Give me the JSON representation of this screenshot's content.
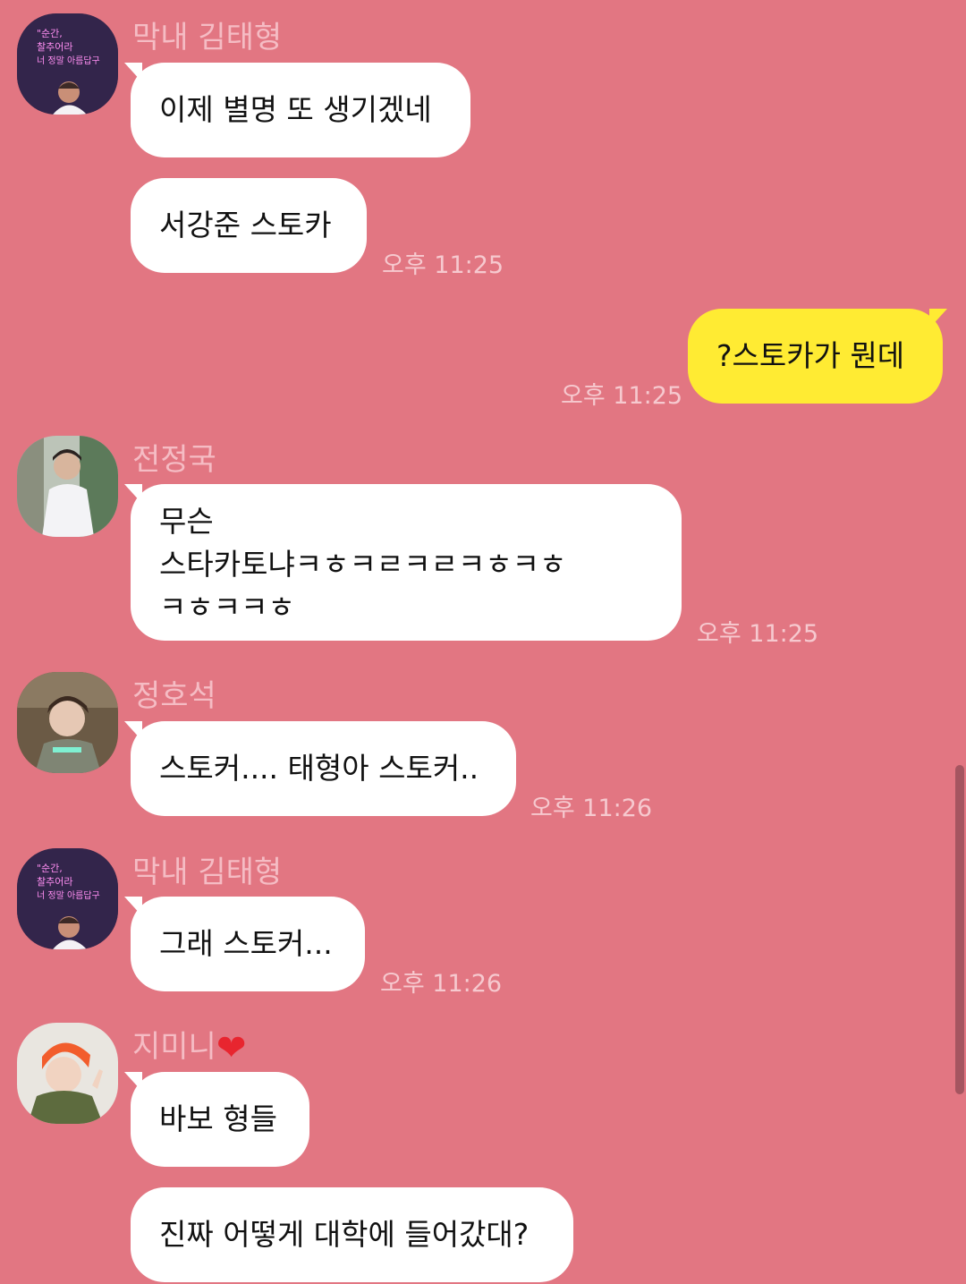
{
  "messages": [
    {
      "sender": "막내 김태형",
      "text": "이제 별명 또 생기겠네"
    },
    {
      "text": "서강준 스토카",
      "time": "오후 11:25"
    },
    {
      "text": "?스토카가 뭔데",
      "time": "오후 11:25"
    },
    {
      "sender": "전정국",
      "lines": [
        "무슨",
        "스타카토냐ㅋㅎㅋㄹㅋㄹㅋㅎㅋㅎ",
        "ㅋㅎㅋㅋㅎ"
      ],
      "time": "오후 11:25"
    },
    {
      "sender": "정호석",
      "text": "스토커.... 태형아 스토커..",
      "time": "오후 11:26"
    },
    {
      "sender": "막내 김태형",
      "text": "그래 스토커...",
      "time": "오후 11:26"
    },
    {
      "sender": "지미니",
      "sender_emoji": "❤",
      "text": "바보 형들"
    },
    {
      "text": "진짜 어떻게 대학에 들어갔대?"
    }
  ],
  "avatars": {
    "taehyung": {
      "icon": "neon-sign-avatar-icon",
      "text_lines": [
        "\"순간,",
        "찰추어라",
        "너 정말 아름답구"
      ]
    },
    "jungkook": {
      "icon": "person-photo-avatar-icon"
    },
    "hoseok": {
      "icon": "person-photo-avatar-icon"
    },
    "jimin": {
      "icon": "orange-hair-avatar-icon"
    }
  },
  "colors": {
    "background": "#e27682",
    "incoming_bubble": "#ffffff",
    "outgoing_bubble": "#ffeb33"
  }
}
